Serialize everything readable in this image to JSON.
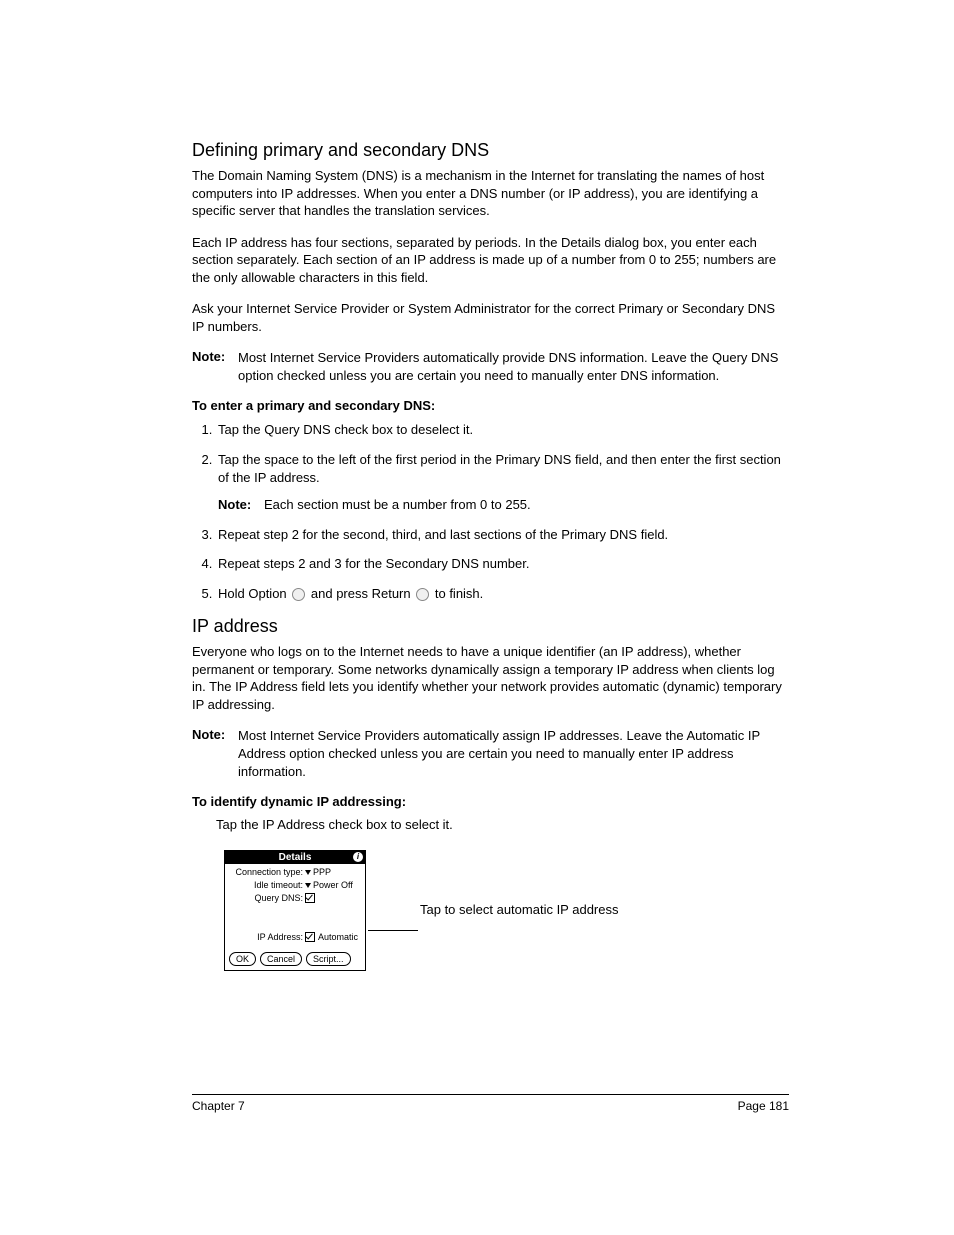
{
  "section1": {
    "heading": "Defining primary and secondary DNS",
    "p1": "The Domain Naming System (DNS) is a mechanism in the Internet for translating the names of host computers into IP addresses. When you enter a DNS number (or IP address), you are identifying a specific server that handles the translation services.",
    "p2": "Each IP address has four sections, separated by periods. In the Details dialog box, you enter each section separately. Each section of an IP address is made up of a number from 0 to 255; numbers are the only allowable characters in this field.",
    "p3": "Ask your Internet Service Provider or System Administrator for the correct Primary or Secondary DNS IP numbers.",
    "note_label": "Note:",
    "note_body": "Most Internet Service Providers automatically provide DNS information. Leave the Query DNS option checked unless you are certain you need to manually enter DNS information.",
    "subhead": "To enter a primary and secondary DNS:",
    "steps": {
      "s1": "Tap the Query DNS check box to deselect it.",
      "s2": "Tap the space to the left of the first period in the Primary DNS field, and then enter the first section of the IP address.",
      "s2_note_label": "Note:",
      "s2_note_body": "Each section must be a number from 0 to 255.",
      "s3": "Repeat step 2 for the second, third, and last sections of the Primary DNS field.",
      "s4": "Repeat steps 2 and 3 for the Secondary DNS number.",
      "s5a": "Hold Option ",
      "s5b": " and press Return ",
      "s5c": " to finish."
    }
  },
  "section2": {
    "heading": "IP address",
    "p1": "Everyone who logs on to the Internet needs to have a unique identifier (an IP address), whether permanent or temporary. Some networks dynamically assign a temporary IP address when clients log in. The IP Address field lets you identify whether your network provides automatic (dynamic) temporary IP addressing.",
    "note_label": "Note:",
    "note_body": "Most Internet Service Providers automatically assign IP addresses. Leave the Automatic IP Address option checked unless you are certain you need to manually enter IP address information.",
    "subhead": "To identify dynamic IP addressing:",
    "instr": "Tap the IP Address check box to select it."
  },
  "details": {
    "title": "Details",
    "conn_label": "Connection type:",
    "conn_val": "PPP",
    "idle_label": "Idle timeout:",
    "idle_val": "Power Off",
    "query_label": "Query DNS:",
    "ip_label": "IP Address:",
    "ip_val": "Automatic",
    "ok": "OK",
    "cancel": "Cancel",
    "script": "Script..."
  },
  "callout": "Tap to select automatic IP address",
  "footer": {
    "left": "Chapter 7",
    "right": "Page 181"
  }
}
